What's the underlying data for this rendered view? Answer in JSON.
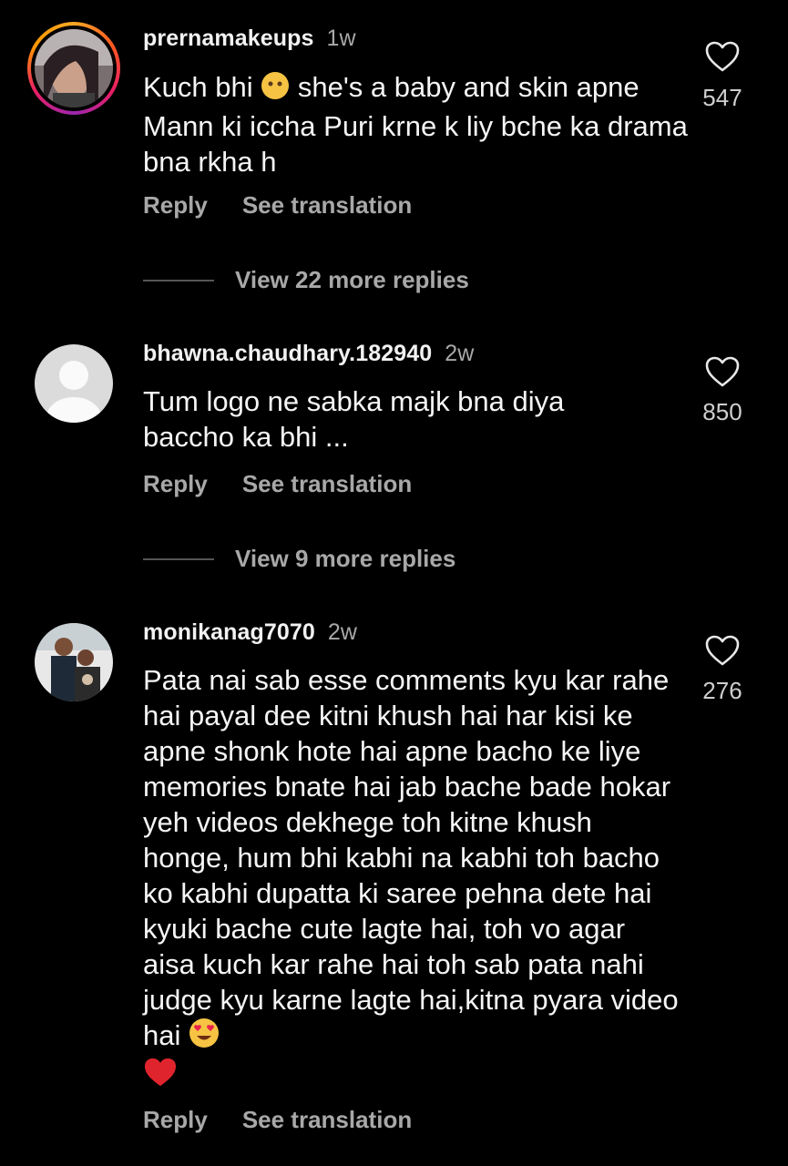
{
  "comments": [
    {
      "username": "prernamakeups",
      "time": "1w",
      "text_part1": "Kuch bhi ",
      "text_part2": " she's a baby and skin apne Mann ki iccha Puri krne k liy bche ka drama bna rkha h",
      "emoji": "neutral-face",
      "likes": "547",
      "reply_label": "Reply",
      "translate_label": "See translation",
      "view_replies": "View 22 more replies"
    },
    {
      "username": "bhawna.chaudhary.182940",
      "time": "2w",
      "text": "Tum logo ne sabka majk bna diya baccho ka bhi ...",
      "likes": "850",
      "reply_label": "Reply",
      "translate_label": "See translation",
      "view_replies": "View 9 more replies"
    },
    {
      "username": "monikanag7070",
      "time": "2w",
      "text": "Pata nai sab esse comments kyu kar rahe hai payal dee kitni khush hai har kisi ke apne shonk hote hai apne bacho ke liye memories bnate hai jab bache bade hokar yeh videos dekhege toh kitne khush honge, hum bhi kabhi na kabhi toh bacho ko kabhi dupatta ki saree pehna dete hai kyuki bache cute lagte hai, toh vo agar aisa kuch kar rahe hai toh sab pata nahi judge kyu karne lagte hai,kitna pyara video hai ",
      "emojis": [
        "heart-eyes",
        "red-heart"
      ],
      "likes": "276",
      "reply_label": "Reply",
      "translate_label": "See translation"
    }
  ],
  "colors": {
    "background": "#000000",
    "text": "#f5f5f5",
    "muted": "#a8a8a8",
    "story_ring": "#e91e63"
  }
}
